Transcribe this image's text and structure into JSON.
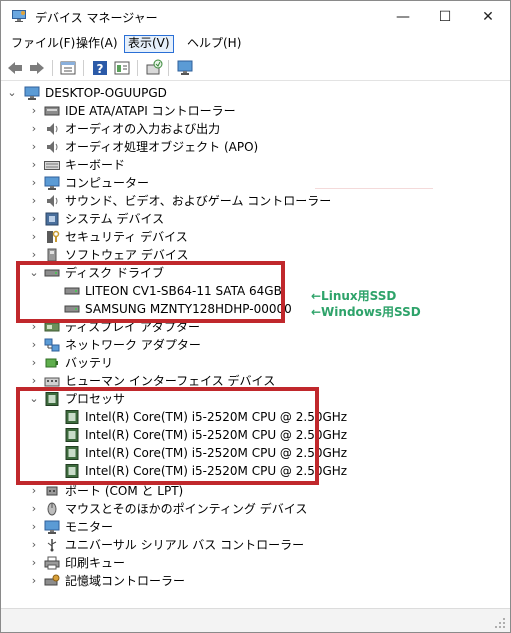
{
  "window": {
    "title": "デバイス マネージャー",
    "controls": {
      "minimize": "—",
      "maximize": "☐",
      "close": "✕"
    }
  },
  "menu": {
    "file": "ファイル(F)",
    "action": "操作(A)",
    "view": "表示(V)",
    "help": "ヘルプ(H)"
  },
  "toolbar": {
    "buttons": [
      "back-icon",
      "forward-icon",
      "properties-icon",
      "help-icon",
      "view-icon",
      "scan-hardware-icon",
      "monitor-icon"
    ]
  },
  "tree": {
    "root": "DESKTOP-OGUUPGD",
    "categories": [
      {
        "label": "IDE ATA/ATAPI コントローラー",
        "icon": "ide-controller-icon",
        "expanded": false
      },
      {
        "label": "オーディオの入力および出力",
        "icon": "speaker-icon",
        "expanded": false
      },
      {
        "label": "オーディオ処理オブジェクト (APO)",
        "icon": "speaker-icon",
        "expanded": false
      },
      {
        "label": "キーボード",
        "icon": "keyboard-icon",
        "expanded": false
      },
      {
        "label": "コンピューター",
        "icon": "computer-icon",
        "expanded": false
      },
      {
        "label": "サウンド、ビデオ、およびゲーム コントローラー",
        "icon": "speaker-icon",
        "expanded": false
      },
      {
        "label": "システム デバイス",
        "icon": "system-device-icon",
        "expanded": false
      },
      {
        "label": "セキュリティ デバイス",
        "icon": "security-device-icon",
        "expanded": false
      },
      {
        "label": "ソフトウェア デバイス",
        "icon": "software-device-icon",
        "expanded": false
      },
      {
        "label": "ディスク ドライブ",
        "icon": "disk-drive-icon",
        "expanded": true,
        "children": [
          "LITEON CV1-SB64-11 SATA 64GB",
          "SAMSUNG MZNTY128HDHP-00000"
        ]
      },
      {
        "label": "ディスプレイ アダプター",
        "icon": "display-adapter-icon",
        "expanded": false
      },
      {
        "label": "ネットワーク アダプター",
        "icon": "network-adapter-icon",
        "expanded": false
      },
      {
        "label": "バッテリ",
        "icon": "battery-icon",
        "expanded": false
      },
      {
        "label": "ヒューマン インターフェイス デバイス",
        "icon": "hid-icon",
        "expanded": false
      },
      {
        "label": "プロセッサ",
        "icon": "processor-icon",
        "expanded": true,
        "children": [
          "Intel(R) Core(TM) i5-2520M CPU @ 2.50GHz",
          "Intel(R) Core(TM) i5-2520M CPU @ 2.50GHz",
          "Intel(R) Core(TM) i5-2520M CPU @ 2.50GHz",
          "Intel(R) Core(TM) i5-2520M CPU @ 2.50GHz"
        ]
      },
      {
        "label": "ポート (COM と LPT)",
        "icon": "port-icon",
        "expanded": false
      },
      {
        "label": "マウスとそのほかのポインティング デバイス",
        "icon": "mouse-icon",
        "expanded": false
      },
      {
        "label": "モニター",
        "icon": "monitor-icon",
        "expanded": false
      },
      {
        "label": "ユニバーサル シリアル バス コントローラー",
        "icon": "usb-icon",
        "expanded": false
      },
      {
        "label": "印刷キュー",
        "icon": "printer-icon",
        "expanded": false
      },
      {
        "label": "記憶域コントローラー",
        "icon": "storage-controller-icon",
        "expanded": false
      }
    ]
  },
  "annotations": {
    "linux_ssd": "←Linux用SSD",
    "windows_ssd": "←Windows用SSD",
    "highlight_color": "#c0282c",
    "note_color": "#2ea36a"
  },
  "colors": {
    "accent": "#2a6fd6",
    "menu_active_bg": "#e6f0fb"
  }
}
